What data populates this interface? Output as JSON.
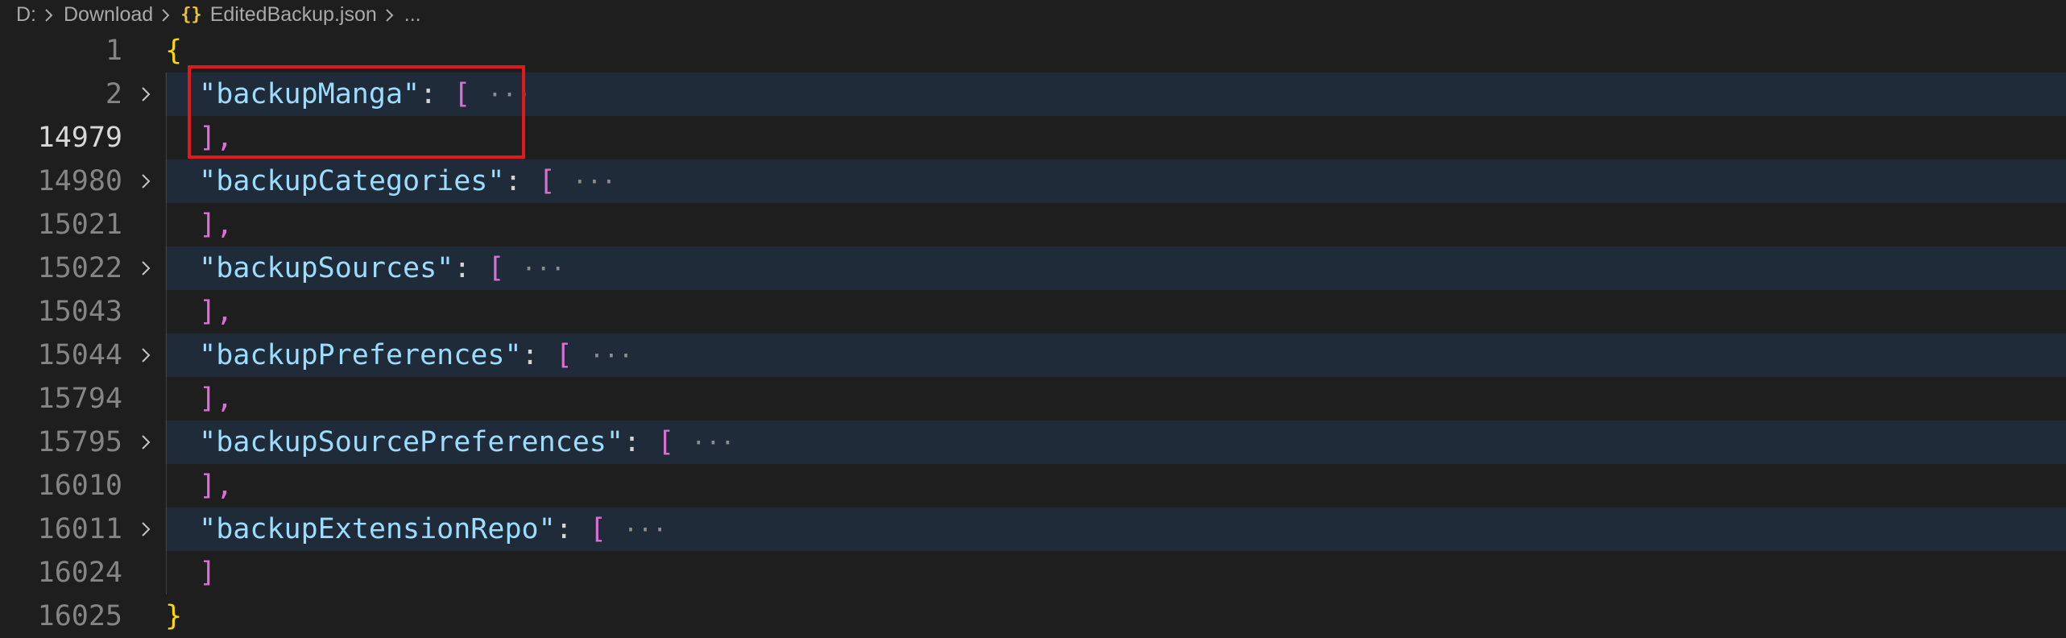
{
  "breadcrumb": {
    "drive": "D:",
    "folder": "Download",
    "file_icon": "{}",
    "file": "EditedBackup.json",
    "more": "..."
  },
  "editor": {
    "lines": [
      {
        "num": "1",
        "open": "{",
        "foldable": false
      },
      {
        "num": "2",
        "key": "\"backupManga\"",
        "sep": ": ",
        "bracket": "[",
        "ellipsis": "···",
        "foldable": true
      },
      {
        "num": "14979",
        "close": "],",
        "active": true
      },
      {
        "num": "14980",
        "key": "\"backupCategories\"",
        "sep": ": ",
        "bracket": "[",
        "ellipsis": "···",
        "foldable": true
      },
      {
        "num": "15021",
        "close": "],"
      },
      {
        "num": "15022",
        "key": "\"backupSources\"",
        "sep": ": ",
        "bracket": "[",
        "ellipsis": "···",
        "foldable": true
      },
      {
        "num": "15043",
        "close": "],"
      },
      {
        "num": "15044",
        "key": "\"backupPreferences\"",
        "sep": ": ",
        "bracket": "[",
        "ellipsis": "···",
        "foldable": true
      },
      {
        "num": "15794",
        "close": "],"
      },
      {
        "num": "15795",
        "key": "\"backupSourcePreferences\"",
        "sep": ": ",
        "bracket": "[",
        "ellipsis": "···",
        "foldable": true
      },
      {
        "num": "16010",
        "close": "],"
      },
      {
        "num": "16011",
        "key": "\"backupExtensionRepo\"",
        "sep": ": ",
        "bracket": "[",
        "ellipsis": "···",
        "foldable": true
      },
      {
        "num": "16024",
        "close": "]"
      },
      {
        "num": "16025",
        "open": "}"
      }
    ]
  },
  "colors": {
    "background": "#1e1e1e",
    "key": "#9cdcfe",
    "bracket": "#da70d6",
    "brace": "#ffd700",
    "highlight_box": "#e01a1a"
  }
}
